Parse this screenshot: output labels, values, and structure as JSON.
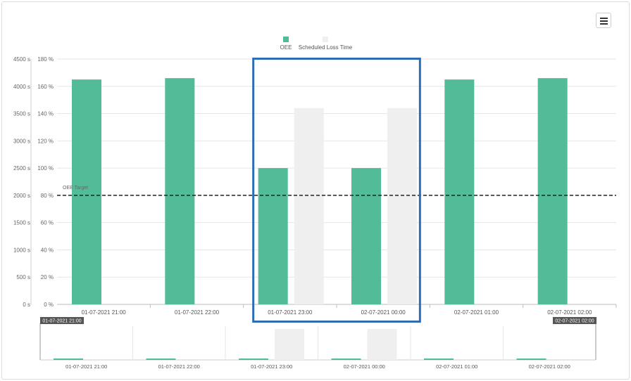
{
  "toolbar": {
    "menu_icon": "hamburger-menu-icon"
  },
  "colors": {
    "oee": "#52bc98",
    "loss": "#efefef",
    "highlight": "#2e6db0",
    "target": "#222222"
  },
  "chart_data": {
    "type": "bar",
    "categories": [
      "01-07-2021 21:00",
      "01-07-2021 22:00",
      "01-07-2021 23:00",
      "02-07-2021 00:00",
      "02-07-2021 01:00",
      "02-07-2021 02:00"
    ],
    "series": [
      {
        "name": "OEE",
        "axis": "right",
        "unit": "%",
        "values": [
          165,
          166,
          100,
          100,
          165,
          166
        ]
      },
      {
        "name": "Scheduled Loss Time",
        "axis": "left",
        "unit": "s",
        "values": [
          0,
          0,
          3600,
          3600,
          0,
          0
        ]
      }
    ],
    "left_axis": {
      "ticks": [
        "0 s",
        "500 s",
        "1000 s",
        "1500 s",
        "2000 s",
        "2500 s",
        "3000 s",
        "3500 s",
        "4000 s",
        "4500 s"
      ],
      "min": 0,
      "max": 4500
    },
    "right_axis": {
      "ticks": [
        "0 %",
        "20 %",
        "40 %",
        "60 %",
        "80 %",
        "100 %",
        "120 %",
        "140 %",
        "160 %",
        "180 %"
      ],
      "min": 0,
      "max": 180
    },
    "target": {
      "label": "OEE Target",
      "value": 80
    },
    "legend": {
      "position": "top-center",
      "labels": [
        "OEE",
        "Scheduled Loss Time"
      ]
    },
    "highlighted_categories": [
      "01-07-2021 23:00",
      "02-07-2021 00:00"
    ],
    "navigator": {
      "range_start": "01-07-2021 21:00",
      "range_end": "02-07-2021 02:00",
      "labels": [
        "01-07-2021 21:00",
        "01-07-2021 22:00",
        "01-07-2021 23:00",
        "02-07-2021 00:00",
        "02-07-2021 01:00",
        "02-07-2021 02:00"
      ]
    },
    "grid": true
  }
}
